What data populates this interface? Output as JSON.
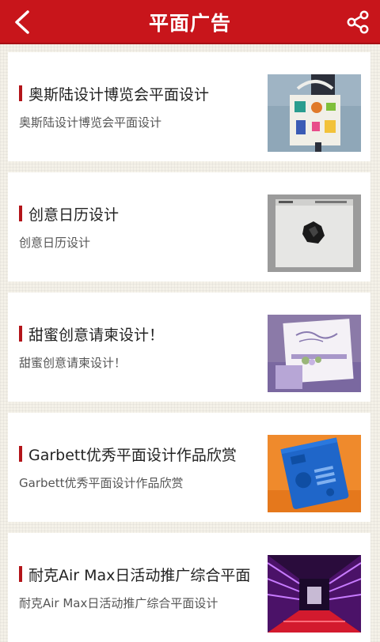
{
  "header": {
    "title": "平面广告",
    "back_icon": "chevron-left-icon",
    "share_icon": "share-icon"
  },
  "articles": [
    {
      "title": "奥斯陆设计博览会平面设计",
      "summary": "奥斯陆设计博览会平面设计",
      "thumbnail": "tote-bag-design-image"
    },
    {
      "title": "创意日历设计",
      "summary": "创意日历设计",
      "thumbnail": "calendar-design-image"
    },
    {
      "title": "甜蜜创意请柬设计！",
      "summary": "甜蜜创意请柬设计！",
      "thumbnail": "invitation-card-image"
    },
    {
      "title": "Garbett优秀平面设计作品欣赏",
      "summary": "Garbett优秀平面设计作品欣赏",
      "thumbnail": "blue-box-design-image"
    },
    {
      "title": "耐克Air Max日活动推广综合平面",
      "summary": "耐克Air Max日活动推广综合平面设计",
      "thumbnail": "neon-tunnel-image"
    }
  ],
  "colors": {
    "header_bg": "#c8151b",
    "accent_bar": "#b3151a",
    "page_bg": "#f4f1e8"
  }
}
